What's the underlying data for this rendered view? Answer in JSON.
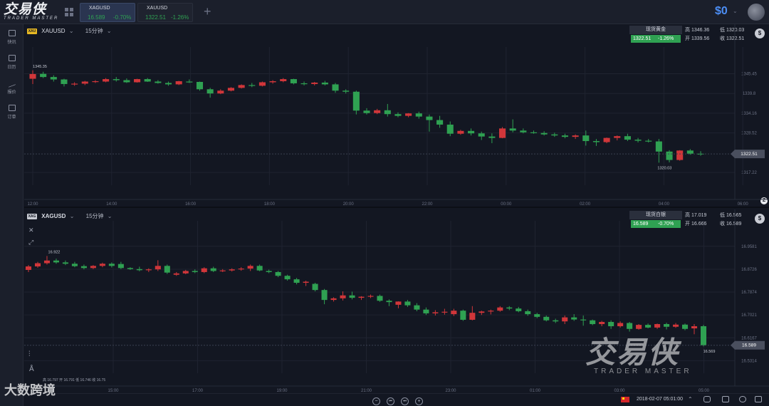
{
  "app": {
    "logo_text": "交易侠",
    "logo_sub": "TRADER MASTER",
    "balance": "$0",
    "balance_caret": "⌄"
  },
  "tabs": [
    {
      "symbol": "XAGUSD",
      "price": "16.589",
      "change": "-0.70%"
    },
    {
      "symbol": "XAUUSD",
      "price": "1322.51",
      "change": "-1.26%"
    }
  ],
  "sidebar": {
    "items": [
      {
        "label": "快讯",
        "icon": "news-icon"
      },
      {
        "label": "日历",
        "icon": "calendar-icon"
      },
      {
        "label": "报价",
        "icon": "quote-icon"
      },
      {
        "label": "订单",
        "icon": "order-icon"
      }
    ]
  },
  "colors": {
    "up": "#d1363a",
    "down": "#2fa152",
    "bg": "#131722",
    "grid": "#1f2330",
    "accent": "#4c8ef5"
  },
  "charts": {
    "top": {
      "badge": "XAU",
      "symbol": "XAUUSD",
      "symbol_caret": "⌄",
      "timeframe": "15分钟",
      "timeframe_caret": "⌄",
      "quote_title": "现货黄金",
      "last": "1322.51",
      "last_change": "-1.26%",
      "high_label": "高",
      "high": "1346.36",
      "low_label": "低",
      "low": "1320.03",
      "open_label": "开",
      "open": "1339.56",
      "close_label": "收",
      "close": "1322.51",
      "price_tag": "1322.51",
      "hi_annot": "1345.35",
      "lo_annot": "1320.03"
    },
    "bottom": {
      "badge": "XAG",
      "symbol": "XAGUSD",
      "symbol_caret": "⌄",
      "timeframe": "15分钟",
      "timeframe_caret": "⌄",
      "quote_title": "现货白银",
      "last": "16.589",
      "last_change": "-0.70%",
      "high_label": "高",
      "high": "17.019",
      "low_label": "低",
      "low": "16.565",
      "open_label": "开",
      "open": "16.666",
      "close_label": "收",
      "close": "16.589",
      "price_tag": "16.589",
      "hi_annot": "16.922",
      "lo_annot": "16.569",
      "ohlc_line": "高 16.797 开 16.791 低 16.746 收 16.75"
    }
  },
  "chart_data": [
    {
      "type": "candlestick",
      "title": "XAUUSD 15分钟",
      "y_ticks": [
        "1345.45",
        "1339.8",
        "1334.16",
        "1328.52",
        "1317.22"
      ],
      "ylim": [
        1314,
        1349
      ],
      "x_ticks": [
        "12:00",
        "14:00",
        "16:00",
        "18:00",
        "20:00",
        "22:00",
        "00:00",
        "02:00",
        "04:00",
        "06:00"
      ],
      "candles": [
        [
          1344.0,
          1346.4,
          1342.5,
          1345.35
        ],
        [
          1345.4,
          1346.0,
          1344.2,
          1344.5
        ],
        [
          1344.5,
          1345.0,
          1343.2,
          1343.8
        ],
        [
          1343.8,
          1344.0,
          1341.8,
          1342.5
        ],
        [
          1342.5,
          1343.0,
          1342.0,
          1342.6
        ],
        [
          1342.6,
          1343.4,
          1342.2,
          1343.2
        ],
        [
          1343.1,
          1343.6,
          1342.8,
          1343.3
        ],
        [
          1343.2,
          1344.2,
          1343.0,
          1343.9
        ],
        [
          1343.9,
          1344.5,
          1343.2,
          1343.6
        ],
        [
          1343.6,
          1344.1,
          1342.8,
          1343.0
        ],
        [
          1343.0,
          1344.0,
          1342.9,
          1343.9
        ],
        [
          1343.9,
          1344.2,
          1343.1,
          1343.2
        ],
        [
          1343.2,
          1343.6,
          1342.6,
          1342.8
        ],
        [
          1342.8,
          1343.2,
          1342.0,
          1342.4
        ],
        [
          1342.4,
          1343.4,
          1342.2,
          1343.3
        ],
        [
          1343.2,
          1343.8,
          1342.8,
          1343.1
        ],
        [
          1343.1,
          1343.2,
          1340.6,
          1341.0
        ],
        [
          1341.0,
          1341.4,
          1338.6,
          1339.8
        ],
        [
          1339.8,
          1341.0,
          1339.6,
          1340.6
        ],
        [
          1340.6,
          1341.6,
          1340.4,
          1341.4
        ],
        [
          1341.4,
          1342.4,
          1341.2,
          1342.2
        ],
        [
          1342.2,
          1342.8,
          1341.6,
          1342.0
        ],
        [
          1342.0,
          1343.2,
          1341.8,
          1343.0
        ],
        [
          1343.0,
          1343.6,
          1342.6,
          1343.3
        ],
        [
          1343.3,
          1344.2,
          1343.0,
          1343.9
        ],
        [
          1343.9,
          1344.0,
          1342.4,
          1342.7
        ],
        [
          1342.7,
          1343.2,
          1342.1,
          1342.5
        ],
        [
          1342.5,
          1343.1,
          1342.1,
          1342.9
        ],
        [
          1342.9,
          1343.4,
          1342.1,
          1342.4
        ],
        [
          1342.4,
          1342.8,
          1340.0,
          1340.6
        ],
        [
          1340.6,
          1341.0,
          1339.8,
          1340.3
        ],
        [
          1340.3,
          1340.6,
          1333.8,
          1334.9
        ],
        [
          1334.9,
          1335.6,
          1333.8,
          1334.2
        ],
        [
          1334.2,
          1335.4,
          1333.9,
          1335.0
        ],
        [
          1335.0,
          1336.8,
          1333.2,
          1333.9
        ],
        [
          1333.9,
          1334.4,
          1333.0,
          1333.4
        ],
        [
          1333.4,
          1334.2,
          1333.0,
          1334.1
        ],
        [
          1334.1,
          1334.6,
          1332.6,
          1333.2
        ],
        [
          1333.2,
          1333.8,
          1328.9,
          1332.2
        ],
        [
          1332.2,
          1333.4,
          1330.0,
          1330.9
        ],
        [
          1330.9,
          1331.8,
          1327.6,
          1328.3
        ],
        [
          1328.3,
          1329.4,
          1328.0,
          1329.1
        ],
        [
          1329.1,
          1329.8,
          1327.8,
          1328.4
        ],
        [
          1328.4,
          1328.9,
          1326.5,
          1327.5
        ],
        [
          1327.5,
          1328.4,
          1325.6,
          1327.1
        ],
        [
          1327.1,
          1330.2,
          1327.0,
          1329.8
        ],
        [
          1329.8,
          1332.4,
          1328.7,
          1329.2
        ],
        [
          1329.2,
          1329.8,
          1328.4,
          1328.7
        ],
        [
          1328.7,
          1329.2,
          1328.3,
          1328.5
        ],
        [
          1328.5,
          1329.0,
          1327.8,
          1328.1
        ],
        [
          1328.1,
          1328.6,
          1327.4,
          1327.8
        ],
        [
          1327.8,
          1328.3,
          1327.0,
          1327.4
        ],
        [
          1327.4,
          1328.1,
          1326.8,
          1327.8
        ],
        [
          1327.8,
          1329.2,
          1324.9,
          1326.2
        ],
        [
          1326.2,
          1326.8,
          1324.8,
          1325.9
        ],
        [
          1325.9,
          1327.2,
          1325.6,
          1327.1
        ],
        [
          1327.1,
          1327.8,
          1326.4,
          1327.6
        ],
        [
          1327.6,
          1328.3,
          1326.2,
          1326.6
        ],
        [
          1326.6,
          1327.1,
          1325.8,
          1326.3
        ],
        [
          1326.3,
          1326.8,
          1325.8,
          1326.1
        ],
        [
          1326.1,
          1326.8,
          1320.03,
          1323.2
        ],
        [
          1323.2,
          1323.6,
          1320.1,
          1320.8
        ],
        [
          1320.8,
          1323.6,
          1320.6,
          1323.5
        ],
        [
          1323.5,
          1323.9,
          1322.3,
          1322.6
        ],
        [
          1322.6,
          1323.3,
          1322.0,
          1322.51
        ]
      ]
    },
    {
      "type": "candlestick",
      "title": "XAGUSD 15分钟",
      "y_ticks": [
        "16.9581",
        "16.8726",
        "16.7874",
        "16.7021",
        "16.6167",
        "16.5314"
      ],
      "ylim": [
        16.49,
        17.0
      ],
      "x_ticks": [
        "15:00",
        "17:00",
        "19:00",
        "21:00",
        "23:00",
        "01:00",
        "03:00",
        "05:00"
      ],
      "candles": [
        [
          16.87,
          16.888,
          16.862,
          16.883
        ],
        [
          16.883,
          16.9,
          16.878,
          16.895
        ],
        [
          16.895,
          16.922,
          16.89,
          16.905
        ],
        [
          16.905,
          16.912,
          16.893,
          16.898
        ],
        [
          16.898,
          16.905,
          16.888,
          16.893
        ],
        [
          16.893,
          16.9,
          16.88,
          16.884
        ],
        [
          16.884,
          16.89,
          16.872,
          16.877
        ],
        [
          16.877,
          16.888,
          16.873,
          16.885
        ],
        [
          16.885,
          16.897,
          16.88,
          16.893
        ],
        [
          16.893,
          16.898,
          16.879,
          16.885
        ],
        [
          16.892,
          16.9,
          16.873,
          16.877
        ],
        [
          16.877,
          16.88,
          16.87,
          16.873
        ],
        [
          16.873,
          16.882,
          16.865,
          16.869
        ],
        [
          16.869,
          16.876,
          16.862,
          16.872
        ],
        [
          16.872,
          16.906,
          16.866,
          16.885
        ],
        [
          16.885,
          16.89,
          16.855,
          16.86
        ],
        [
          16.852,
          16.862,
          16.848,
          16.857
        ],
        [
          16.857,
          16.87,
          16.854,
          16.866
        ],
        [
          16.866,
          16.872,
          16.858,
          16.862
        ],
        [
          16.862,
          16.88,
          16.858,
          16.876
        ],
        [
          16.876,
          16.882,
          16.862,
          16.866
        ],
        [
          16.866,
          16.873,
          16.862,
          16.868
        ],
        [
          16.868,
          16.876,
          16.864,
          16.872
        ],
        [
          16.872,
          16.88,
          16.867,
          16.875
        ],
        [
          16.875,
          16.89,
          16.866,
          16.885
        ],
        [
          16.885,
          16.89,
          16.865,
          16.868
        ],
        [
          16.866,
          16.871,
          16.858,
          16.862
        ],
        [
          16.862,
          16.866,
          16.843,
          16.848
        ],
        [
          16.848,
          16.852,
          16.83,
          16.835
        ],
        [
          16.835,
          16.84,
          16.816,
          16.822
        ],
        [
          16.822,
          16.83,
          16.81,
          16.826
        ],
        [
          16.818,
          16.822,
          16.79,
          16.795
        ],
        [
          16.795,
          16.799,
          16.742,
          16.758
        ],
        [
          16.758,
          16.768,
          16.752,
          16.764
        ],
        [
          16.764,
          16.79,
          16.756,
          16.775
        ],
        [
          16.775,
          16.789,
          16.76,
          16.766
        ],
        [
          16.766,
          16.772,
          16.758,
          16.77
        ],
        [
          16.77,
          16.778,
          16.765,
          16.773
        ],
        [
          16.773,
          16.778,
          16.751,
          16.755
        ],
        [
          16.755,
          16.76,
          16.735,
          16.75
        ],
        [
          16.74,
          16.753,
          16.727,
          16.752
        ],
        [
          16.752,
          16.758,
          16.732,
          16.738
        ],
        [
          16.738,
          16.746,
          16.716,
          16.722
        ],
        [
          16.722,
          16.73,
          16.702,
          16.708
        ],
        [
          16.708,
          16.72,
          16.7,
          16.712
        ],
        [
          16.712,
          16.725,
          16.703,
          16.714
        ],
        [
          16.705,
          16.725,
          16.698,
          16.718
        ],
        [
          16.718,
          16.722,
          16.68,
          16.684
        ],
        [
          16.684,
          16.735,
          16.682,
          16.71
        ],
        [
          16.71,
          16.718,
          16.702,
          16.715
        ],
        [
          16.715,
          16.722,
          16.704,
          16.718
        ],
        [
          16.718,
          16.735,
          16.714,
          16.73
        ],
        [
          16.73,
          16.735,
          16.72,
          16.726
        ],
        [
          16.726,
          16.732,
          16.712,
          16.716
        ],
        [
          16.716,
          16.722,
          16.699,
          16.705
        ],
        [
          16.705,
          16.71,
          16.69,
          16.695
        ],
        [
          16.695,
          16.7,
          16.678,
          16.682
        ],
        [
          16.682,
          16.688,
          16.672,
          16.678
        ],
        [
          16.678,
          16.7,
          16.668,
          16.693
        ],
        [
          16.693,
          16.705,
          16.68,
          16.685
        ],
        [
          16.685,
          16.7,
          16.662,
          16.682
        ],
        [
          16.682,
          16.685,
          16.664,
          16.668
        ],
        [
          16.668,
          16.68,
          16.66,
          16.676
        ],
        [
          16.676,
          16.682,
          16.65,
          16.66
        ],
        [
          16.66,
          16.678,
          16.655,
          16.672
        ],
        [
          16.672,
          16.676,
          16.64,
          16.65
        ],
        [
          16.65,
          16.668,
          16.647,
          16.665
        ],
        [
          16.665,
          16.67,
          16.652,
          16.655
        ],
        [
          16.655,
          16.67,
          16.65,
          16.668
        ],
        [
          16.668,
          16.673,
          16.648,
          16.658
        ],
        [
          16.658,
          16.672,
          16.654,
          16.666
        ],
        [
          16.666,
          16.67,
          16.645,
          16.65
        ],
        [
          16.652,
          16.668,
          16.63,
          16.66
        ],
        [
          16.66,
          16.665,
          16.585,
          16.589
        ]
      ]
    }
  ],
  "toolbar": {
    "zoom_out": "−",
    "prev": "⏮",
    "next": "⏭",
    "zoom_in": "+"
  },
  "status": {
    "datetime": "2018-02-07 05:01:00",
    "caret": "⌃"
  },
  "watermark": {
    "big": "交易侠",
    "small": "TRADER MASTER",
    "brand": "大数跨境"
  }
}
